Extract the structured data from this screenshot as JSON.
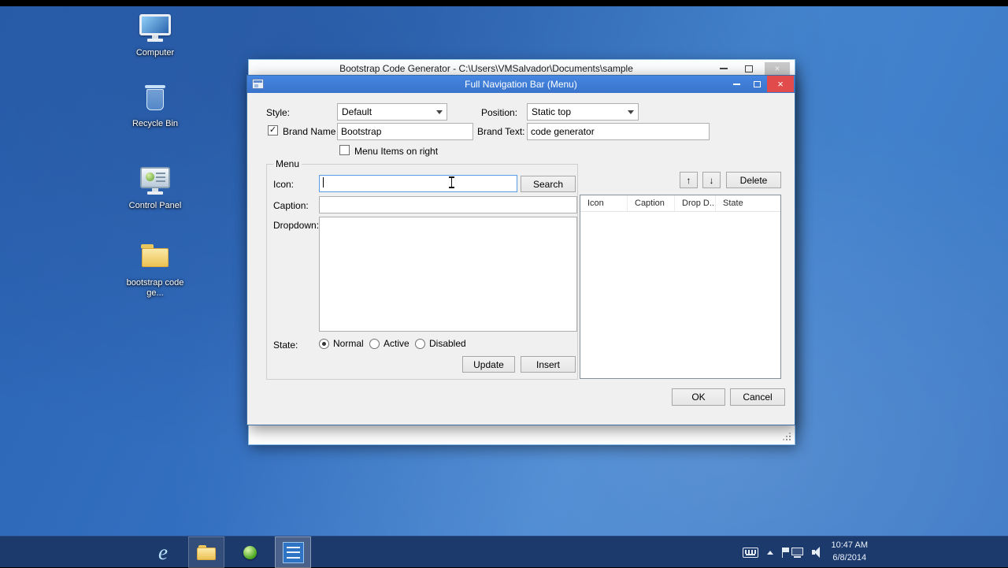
{
  "icons": {
    "check": "✓",
    "close": "×"
  },
  "desktop": {
    "icons": [
      {
        "label": "Computer"
      },
      {
        "label": "Recycle Bin"
      },
      {
        "label": "Control Panel"
      },
      {
        "label": "bootstrap code ge..."
      }
    ]
  },
  "main_window": {
    "title": "Bootstrap Code Generator - C:\\Users\\VMSalvador\\Documents\\sample"
  },
  "dialog": {
    "title": "Full Navigation Bar (Menu)",
    "style_label": "Style:",
    "style_value": "Default",
    "position_label": "Position:",
    "position_value": "Static top",
    "brand_name_label": "Brand Name",
    "brand_name_checked": true,
    "brand_name_value": "Bootstrap",
    "brand_text_label": "Brand Text:",
    "brand_text_value": "code generator",
    "menu_items_right_label": "Menu Items on right",
    "menu_items_right_checked": false,
    "menu_group_label": "Menu",
    "icon_label": "Icon:",
    "icon_value": "",
    "search_button": "Search",
    "caption_label": "Caption:",
    "caption_value": "",
    "dropdown_label": "Dropdown:",
    "dropdown_value": "",
    "state_label": "State:",
    "state_options": [
      "Normal",
      "Active",
      "Disabled"
    ],
    "state_selected": "Normal",
    "update_button": "Update",
    "insert_button": "Insert",
    "up_button": "↑",
    "down_button": "↓",
    "delete_button": "Delete",
    "list_columns": [
      "Icon",
      "Caption",
      "Drop D...",
      "State"
    ],
    "ok_button": "OK",
    "cancel_button": "Cancel"
  },
  "taskbar": {
    "time": "10:47 AM",
    "date": "6/8/2014"
  }
}
